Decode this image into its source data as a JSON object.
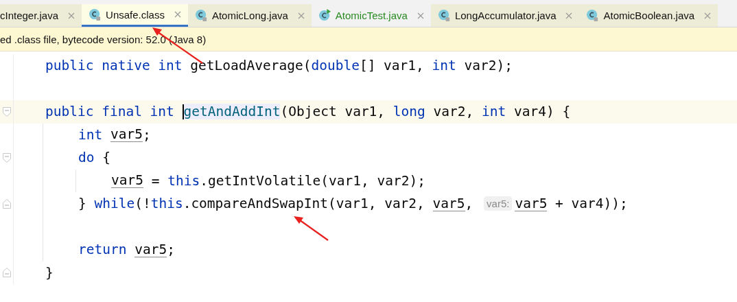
{
  "tabs": [
    {
      "label": "cInteger.java",
      "selected": false,
      "tinted": true,
      "added": false
    },
    {
      "label": "Unsafe.class",
      "selected": true,
      "kind": "library",
      "tinted": true,
      "added": false
    },
    {
      "label": "AtomicLong.java",
      "selected": false,
      "kind": "library",
      "tinted": true,
      "added": false
    },
    {
      "label": "AtomicTest.java",
      "selected": false,
      "kind": "runnable",
      "tinted": false,
      "added": true
    },
    {
      "label": "LongAccumulator.java",
      "selected": false,
      "kind": "library",
      "tinted": true,
      "added": false
    },
    {
      "label": "AtomicBoolean.java",
      "selected": false,
      "kind": "library",
      "tinted": true,
      "added": false
    }
  ],
  "banner": {
    "text": "ed .class file, bytecode version: 52.0 (Java 8)"
  },
  "code": {
    "lines": [
      {
        "kind": "code",
        "current": false,
        "tokens": [
          {
            "kind": "kw",
            "text": "public native int"
          },
          {
            "kind": "text",
            "text": " getLoadAverage("
          },
          {
            "kind": "kw",
            "text": "double"
          },
          {
            "kind": "text",
            "text": "[] var1, "
          },
          {
            "kind": "kw",
            "text": "int"
          },
          {
            "kind": "text",
            "text": " var2);"
          }
        ]
      },
      {
        "kind": "blank"
      },
      {
        "kind": "code",
        "current": true,
        "fold_start": true,
        "tokens": [
          {
            "kind": "kw",
            "text": "public final int "
          },
          {
            "kind": "fn",
            "text": "getAndAddInt",
            "caret": true
          },
          {
            "kind": "text",
            "text": "(Object var1, "
          },
          {
            "kind": "kw",
            "text": "long"
          },
          {
            "kind": "text",
            "text": " var2, "
          },
          {
            "kind": "kw",
            "text": "int"
          },
          {
            "kind": "text",
            "text": " var4) {"
          }
        ],
        "children": [
          {
            "kind": "code",
            "current": false,
            "tokens": [
              {
                "kind": "kw",
                "text": "int "
              },
              {
                "kind": "var",
                "text": "var5"
              },
              {
                "kind": "text",
                "text": ";"
              }
            ]
          },
          {
            "kind": "code",
            "current": false,
            "fold_start": true,
            "tokens": [
              {
                "kind": "kw",
                "text": "do"
              },
              {
                "kind": "text",
                "text": " {"
              }
            ],
            "children": [
              {
                "kind": "code",
                "current": false,
                "tokens": [
                  {
                    "kind": "var",
                    "text": "var5"
                  },
                  {
                    "kind": "text",
                    "text": " = "
                  },
                  {
                    "kind": "kw",
                    "text": "this"
                  },
                  {
                    "kind": "text",
                    "text": ".getIntVolatile(var1, var2);"
                  }
                ]
              }
            ]
          },
          {
            "kind": "code",
            "current": false,
            "fold_end": true,
            "tokens": [
              {
                "kind": "text",
                "text": "} "
              },
              {
                "kind": "kw",
                "text": "while"
              },
              {
                "kind": "text",
                "text": "(!"
              },
              {
                "kind": "kw",
                "text": "this"
              },
              {
                "kind": "text",
                "text": ".compareAndSwapInt(var1, var2, "
              },
              {
                "kind": "var",
                "text": "var5"
              },
              {
                "kind": "text",
                "text": ", "
              },
              {
                "kind": "hint",
                "text": "var5:"
              },
              {
                "kind": "var",
                "text": "var5"
              },
              {
                "kind": "text",
                "text": " + var4));"
              }
            ]
          },
          {
            "kind": "blank"
          },
          {
            "kind": "code",
            "current": false,
            "tokens": [
              {
                "kind": "kw",
                "text": "return "
              },
              {
                "kind": "var",
                "text": "var5"
              },
              {
                "kind": "text",
                "text": ";"
              }
            ]
          }
        ]
      },
      {
        "kind": "code",
        "current": false,
        "fold_end": true,
        "tokens": [
          {
            "kind": "text",
            "text": "}"
          }
        ]
      }
    ]
  }
}
